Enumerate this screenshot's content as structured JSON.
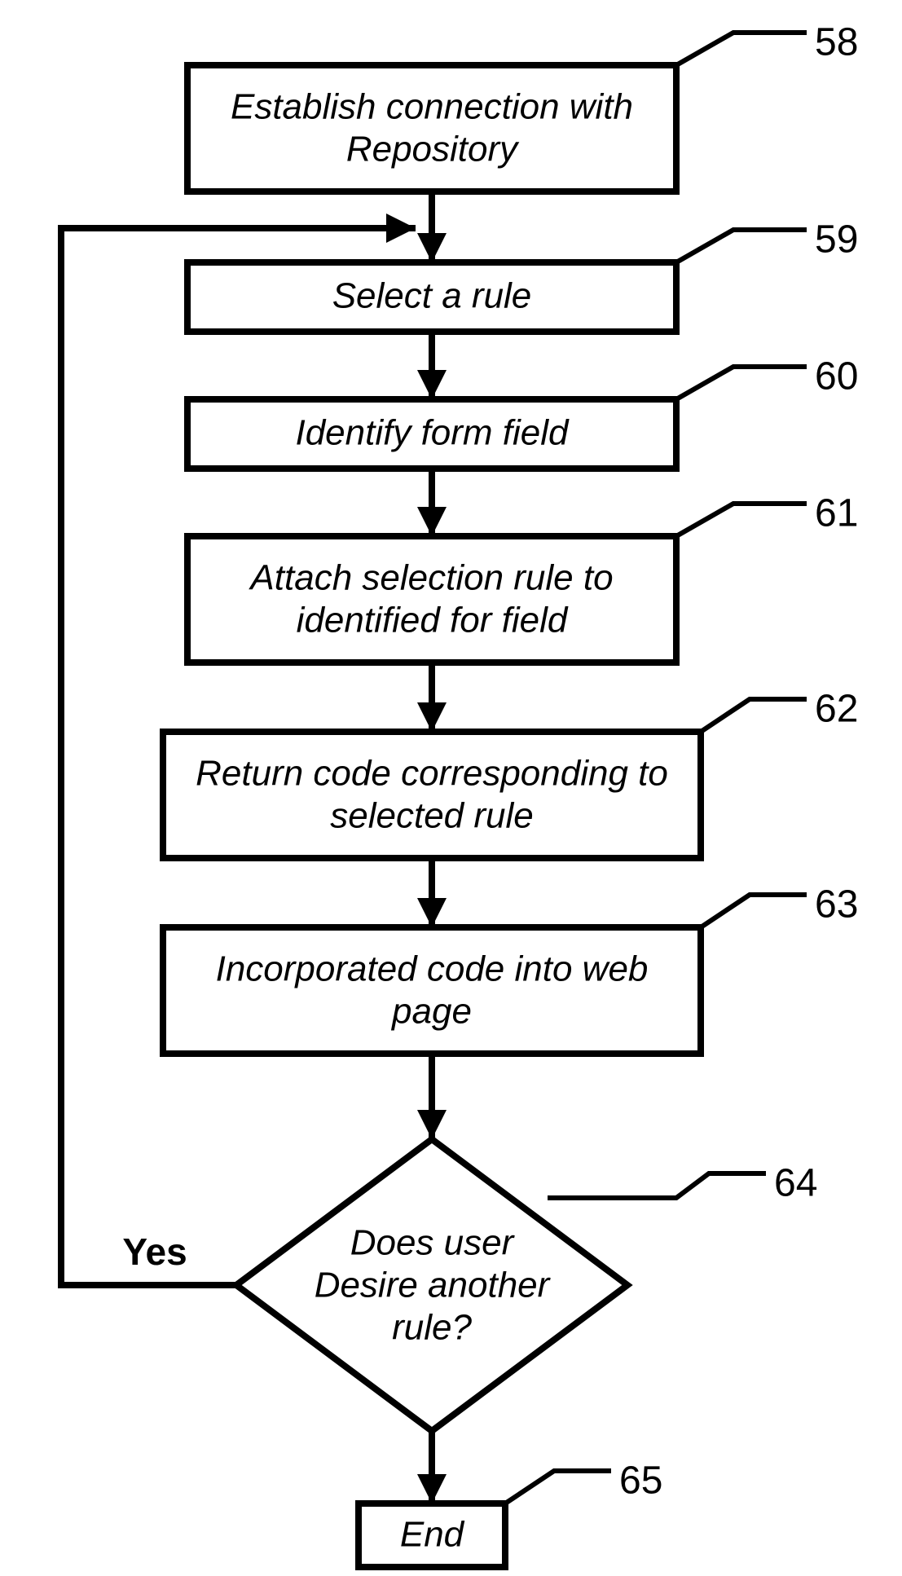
{
  "nodes": {
    "n58": {
      "label": "58",
      "lines": [
        "Establish connection with",
        "Repository"
      ]
    },
    "n59": {
      "label": "59",
      "lines": [
        "Select a rule"
      ]
    },
    "n60": {
      "label": "60",
      "lines": [
        "Identify form field"
      ]
    },
    "n61": {
      "label": "61",
      "lines": [
        "Attach selection rule to",
        "identified for field"
      ]
    },
    "n62": {
      "label": "62",
      "lines": [
        "Return code corresponding to",
        "selected rule"
      ]
    },
    "n63": {
      "label": "63",
      "lines": [
        "Incorporated code into web",
        "page"
      ]
    },
    "n64": {
      "label": "64",
      "lines": [
        "Does user",
        "Desire another",
        "rule?"
      ]
    },
    "n65": {
      "label": "65",
      "lines": [
        "End"
      ]
    }
  },
  "edges": {
    "yes": "Yes"
  },
  "chart_data": {
    "type": "flowchart",
    "title": "",
    "nodes": [
      {
        "id": 58,
        "shape": "process",
        "text": "Establish connection with Repository"
      },
      {
        "id": 59,
        "shape": "process",
        "text": "Select a rule"
      },
      {
        "id": 60,
        "shape": "process",
        "text": "Identify form field"
      },
      {
        "id": 61,
        "shape": "process",
        "text": "Attach selection rule to identified for field"
      },
      {
        "id": 62,
        "shape": "process",
        "text": "Return code corresponding to selected rule"
      },
      {
        "id": 63,
        "shape": "process",
        "text": "Incorporated code into web page"
      },
      {
        "id": 64,
        "shape": "decision",
        "text": "Does user Desire another rule?"
      },
      {
        "id": 65,
        "shape": "terminator",
        "text": "End"
      }
    ],
    "edges": [
      {
        "from": 58,
        "to": 59,
        "label": ""
      },
      {
        "from": 59,
        "to": 60,
        "label": ""
      },
      {
        "from": 60,
        "to": 61,
        "label": ""
      },
      {
        "from": 61,
        "to": 62,
        "label": ""
      },
      {
        "from": 62,
        "to": 63,
        "label": ""
      },
      {
        "from": 63,
        "to": 64,
        "label": ""
      },
      {
        "from": 64,
        "to": 59,
        "label": "Yes"
      },
      {
        "from": 64,
        "to": 65,
        "label": ""
      }
    ]
  }
}
